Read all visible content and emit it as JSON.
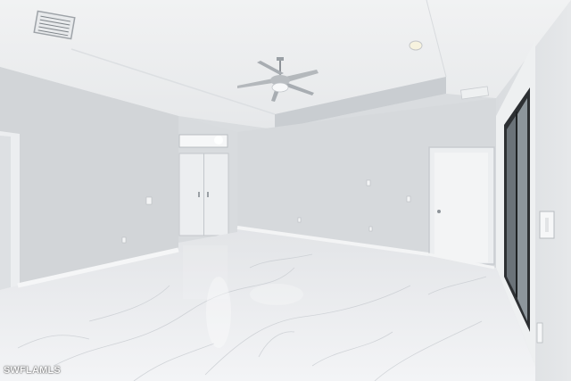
{
  "photo": {
    "watermark": "SWFLAMLS",
    "colors": {
      "ceiling": "#eef0f1",
      "wall_left": "#d4d7da",
      "wall_back": "#d6d9dc",
      "wall_right": "#dfe1e3",
      "floor": "#e9ebee",
      "tray_band": "#c9cdd1",
      "door": "#eceef0",
      "trim": "#f4f5f6",
      "window_frame": "#2d3033"
    }
  }
}
